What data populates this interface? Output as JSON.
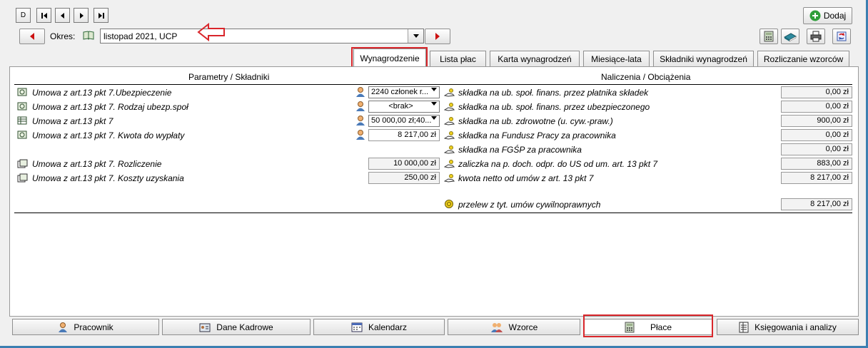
{
  "toolbar": {
    "nav_new": "D",
    "nav_first": "⏮",
    "nav_prev": "◀",
    "nav_next": "▶",
    "nav_last": "⏭",
    "add_label": "Dodaj"
  },
  "period": {
    "label": "Okres:",
    "value": "listopad 2021, UCP"
  },
  "tabs": [
    {
      "label": "Wynagrodzenie"
    },
    {
      "label": "Lista płac"
    },
    {
      "label": "Karta wynagrodzeń"
    },
    {
      "label": "Miesiące-lata"
    },
    {
      "label": "Składniki wynagrodzeń"
    },
    {
      "label": "Rozliczanie wzorców"
    }
  ],
  "panel": {
    "left_header": "Parametry / Składniki",
    "right_header": "Naliczenia / Obciążenia",
    "params": [
      {
        "label": "Umowa z art.13 pkt 7.Ubezpieczenie",
        "value": "2240 członek r...",
        "type": "select"
      },
      {
        "label": "Umowa z art.13 pkt 7. Rodzaj ubezp.społ",
        "value": "<brak>",
        "type": "select"
      },
      {
        "label": "Umowa z art.13 pkt 7",
        "value": "50 000,00 zł;40...",
        "type": "select"
      },
      {
        "label": "Umowa z art.13 pkt 7. Kwota do wypłaty",
        "value": "8 217,00 zł",
        "type": "value"
      },
      {
        "label": "Umowa z art.13 pkt 7. Rozliczenie",
        "value": "10 000,00 zł",
        "type": "value"
      },
      {
        "label": "Umowa z art.13 pkt 7. Koszty uzyskania",
        "value": "250,00 zł",
        "type": "value"
      }
    ],
    "charges": [
      {
        "label": "składka na ub. społ. finans. przez płatnika składek",
        "value": "0,00 zł"
      },
      {
        "label": "składka na ub. społ. finans. przez ubezpieczonego",
        "value": "0,00 zł"
      },
      {
        "label": "składka na ub. zdrowotne (u. cyw.-praw.)",
        "value": "900,00 zł"
      },
      {
        "label": "składka na Fundusz Pracy za pracownika",
        "value": "0,00 zł"
      },
      {
        "label": "składka na FGŚP za pracownika",
        "value": "0,00 zł"
      },
      {
        "label": "zaliczka na p. doch. odpr. do US od um. art. 13 pkt 7",
        "value": "883,00 zł"
      },
      {
        "label": "kwota netto od umów z art. 13 pkt 7",
        "value": "8 217,00 zł"
      }
    ],
    "transfer": {
      "label": "przelew z tyt. umów cywilnoprawnych",
      "value": "8 217,00 zł"
    }
  },
  "bottom_nav": [
    {
      "label": "Pracownik",
      "icon": "person-icon"
    },
    {
      "label": "Dane Kadrowe",
      "icon": "id-card-icon"
    },
    {
      "label": "Kalendarz",
      "icon": "calendar-icon"
    },
    {
      "label": "Wzorce",
      "icon": "group-icon"
    },
    {
      "label": "Płace",
      "icon": "calculator-icon"
    },
    {
      "label": "Księgowania i analizy",
      "icon": "ledger-icon"
    }
  ],
  "colors": {
    "highlight_red": "#d9262b",
    "arrow_red": "#cc1111",
    "add_green": "#2e9e3a"
  }
}
